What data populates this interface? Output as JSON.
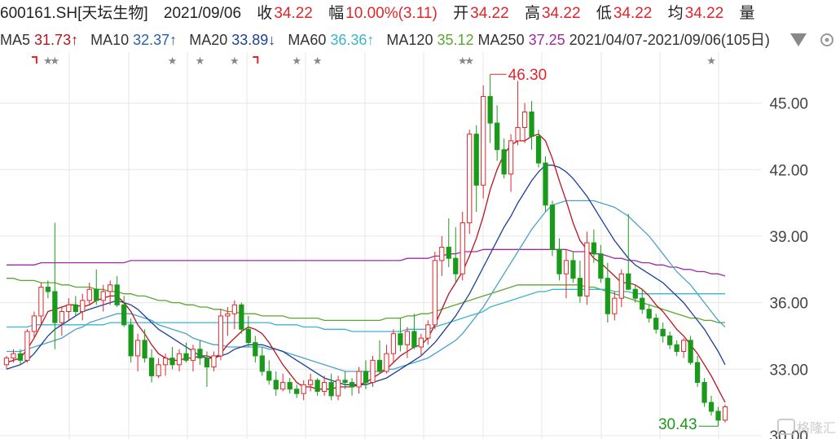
{
  "header": {
    "code": "600161.SH[天坛生物]",
    "date": "2021/09/06",
    "close_label": "收",
    "close": "34.22",
    "change_label": "幅",
    "change": "10.00%(3.11)",
    "open_label": "开",
    "open": "34.22",
    "high_label": "高",
    "high": "34.22",
    "low_label": "低",
    "low": "34.22",
    "avg_label": "均",
    "avg": "34.22",
    "vol_label": "量"
  },
  "ma_bar": {
    "ma5": "MA5",
    "ma5_val": "31.73↑",
    "ma10": "MA10",
    "ma10_val": "32.37↑",
    "ma20": "MA20",
    "ma20_val": "33.89↓",
    "ma60": "MA60",
    "ma60_val": "36.36↑",
    "ma120": "MA120",
    "ma120_val": "35.12",
    "ma250": "MA250",
    "ma250_val": "37.25",
    "range": "2021/04/07-2021/09/06(105日)",
    "dropdown_icon": "triangle-down-icon",
    "settings_icon": "settings-icon"
  },
  "colors": {
    "up": "#e0262b",
    "down": "#1a9a1a",
    "ma5": "#b8141e",
    "ma10": "#1e3f9a",
    "ma20": "#4aa3c8",
    "ma60": "#3ab5cf",
    "ma120": "#5aa630",
    "ma250": "#a02aa0"
  },
  "chart_data": {
    "type": "candlestick",
    "ylim": [
      29.85,
      47.3
    ],
    "yticks": [
      "45.00",
      "42.00",
      "39.00",
      "36.00",
      "33.00",
      "30.00"
    ],
    "ytick_values": [
      45,
      42,
      39,
      36,
      33,
      30
    ],
    "annotations": {
      "high": "46.30",
      "high_value": 46.3,
      "low": "30.43",
      "low_value": 30.43
    },
    "candles": [
      [
        33.2,
        33.6,
        33.0,
        33.5
      ],
      [
        33.5,
        33.9,
        33.3,
        33.7
      ],
      [
        33.7,
        33.9,
        33.2,
        33.4
      ],
      [
        33.4,
        34.8,
        33.3,
        34.7
      ],
      [
        34.7,
        35.6,
        34.4,
        35.4
      ],
      [
        35.4,
        36.9,
        35.0,
        36.7
      ],
      [
        36.7,
        37.0,
        36.2,
        36.5
      ],
      [
        36.5,
        39.6,
        33.9,
        35.1
      ],
      [
        35.1,
        35.8,
        34.5,
        35.6
      ],
      [
        35.6,
        36.2,
        35.2,
        35.9
      ],
      [
        35.9,
        36.3,
        35.4,
        35.6
      ],
      [
        35.6,
        36.4,
        35.2,
        36.1
      ],
      [
        36.1,
        36.9,
        35.9,
        36.6
      ],
      [
        36.6,
        37.5,
        35.9,
        36.1
      ],
      [
        36.1,
        36.8,
        35.6,
        36.5
      ],
      [
        36.5,
        37.0,
        35.9,
        36.8
      ],
      [
        36.8,
        37.2,
        35.8,
        35.9
      ],
      [
        35.9,
        36.3,
        34.9,
        35.0
      ],
      [
        35.0,
        35.3,
        33.3,
        33.6
      ],
      [
        33.6,
        34.6,
        32.9,
        34.3
      ],
      [
        34.3,
        34.8,
        33.3,
        33.5
      ],
      [
        33.5,
        33.9,
        32.4,
        32.7
      ],
      [
        32.7,
        33.5,
        32.6,
        33.2
      ],
      [
        33.2,
        33.7,
        32.7,
        33.5
      ],
      [
        33.5,
        34.0,
        33.0,
        33.2
      ],
      [
        33.2,
        33.9,
        32.9,
        33.7
      ],
      [
        33.7,
        34.2,
        33.3,
        33.4
      ],
      [
        33.4,
        34.1,
        32.9,
        33.9
      ],
      [
        33.9,
        34.3,
        33.2,
        33.5
      ],
      [
        33.5,
        33.8,
        32.2,
        33.1
      ],
      [
        33.1,
        33.8,
        32.9,
        33.6
      ],
      [
        33.6,
        35.7,
        33.4,
        35.4
      ],
      [
        35.4,
        35.8,
        34.5,
        35.5
      ],
      [
        35.5,
        36.1,
        34.8,
        35.9
      ],
      [
        35.9,
        36.0,
        34.6,
        34.8
      ],
      [
        34.8,
        35.4,
        34.0,
        34.2
      ],
      [
        34.2,
        34.5,
        33.3,
        33.6
      ],
      [
        33.6,
        34.0,
        32.7,
        32.9
      ],
      [
        32.9,
        33.4,
        32.3,
        32.5
      ],
      [
        32.5,
        32.9,
        31.8,
        32.1
      ],
      [
        32.1,
        32.8,
        32.0,
        32.4
      ],
      [
        32.4,
        32.6,
        31.9,
        32.1
      ],
      [
        32.1,
        32.3,
        31.7,
        31.9
      ],
      [
        31.9,
        32.5,
        31.6,
        32.3
      ],
      [
        32.3,
        32.8,
        32.0,
        32.5
      ],
      [
        32.5,
        32.6,
        31.8,
        32.0
      ],
      [
        32.0,
        32.7,
        31.8,
        32.4
      ],
      [
        32.4,
        32.8,
        31.6,
        31.8
      ],
      [
        31.8,
        32.7,
        31.6,
        32.5
      ],
      [
        32.5,
        32.9,
        32.1,
        32.4
      ],
      [
        32.4,
        32.6,
        31.8,
        32.2
      ],
      [
        32.2,
        33.1,
        31.9,
        32.9
      ],
      [
        32.9,
        33.4,
        32.1,
        32.4
      ],
      [
        32.4,
        33.6,
        32.2,
        33.4
      ],
      [
        33.4,
        34.3,
        32.8,
        32.9
      ],
      [
        32.9,
        34.1,
        32.8,
        33.7
      ],
      [
        33.7,
        34.8,
        33.3,
        34.6
      ],
      [
        34.6,
        35.3,
        33.8,
        34.1
      ],
      [
        34.1,
        34.9,
        33.5,
        34.7
      ],
      [
        34.7,
        35.5,
        33.9,
        34.0
      ],
      [
        34.0,
        34.6,
        33.6,
        34.4
      ],
      [
        34.4,
        35.2,
        34.1,
        35.0
      ],
      [
        35.0,
        38.3,
        34.8,
        37.9
      ],
      [
        37.9,
        39.0,
        37.2,
        38.5
      ],
      [
        38.5,
        39.8,
        37.6,
        38.0
      ],
      [
        38.0,
        39.4,
        36.9,
        37.3
      ],
      [
        37.3,
        40.1,
        37.0,
        39.6
      ],
      [
        39.6,
        43.8,
        39.1,
        43.6
      ],
      [
        43.6,
        44.0,
        40.1,
        41.3
      ],
      [
        41.3,
        45.8,
        40.7,
        45.3
      ],
      [
        45.3,
        46.3,
        43.2,
        44.1
      ],
      [
        44.1,
        44.9,
        42.4,
        42.9
      ],
      [
        42.9,
        43.4,
        41.6,
        41.8
      ],
      [
        41.8,
        43.6,
        41.0,
        43.3
      ],
      [
        43.3,
        46.0,
        43.1,
        43.9
      ],
      [
        43.9,
        45.0,
        43.2,
        44.6
      ],
      [
        44.6,
        45.1,
        42.9,
        43.5
      ],
      [
        43.5,
        43.8,
        42.1,
        42.3
      ],
      [
        42.3,
        42.6,
        40.1,
        40.4
      ],
      [
        40.4,
        40.6,
        38.1,
        38.4
      ],
      [
        38.4,
        38.9,
        37.0,
        37.3
      ],
      [
        37.3,
        38.4,
        36.2,
        37.9
      ],
      [
        37.9,
        38.3,
        36.9,
        37.1
      ],
      [
        37.1,
        37.9,
        36.0,
        36.3
      ],
      [
        36.3,
        39.2,
        35.9,
        38.7
      ],
      [
        38.7,
        39.3,
        37.8,
        38.2
      ],
      [
        38.2,
        38.6,
        36.9,
        37.1
      ],
      [
        37.1,
        37.8,
        35.1,
        35.5
      ],
      [
        35.5,
        36.5,
        35.2,
        36.2
      ],
      [
        36.2,
        37.5,
        35.8,
        37.3
      ],
      [
        37.3,
        40.0,
        36.9,
        36.6
      ],
      [
        36.6,
        36.8,
        36.0,
        36.2
      ],
      [
        36.2,
        36.6,
        35.5,
        35.7
      ],
      [
        35.7,
        35.9,
        35.1,
        35.3
      ],
      [
        35.3,
        35.5,
        34.6,
        34.8
      ],
      [
        34.8,
        35.1,
        34.2,
        34.5
      ],
      [
        34.5,
        34.7,
        33.9,
        34.1
      ],
      [
        34.1,
        34.3,
        33.6,
        33.8
      ],
      [
        33.8,
        34.4,
        33.5,
        34.3
      ],
      [
        34.3,
        34.5,
        33.2,
        33.3
      ],
      [
        33.3,
        33.6,
        32.2,
        32.4
      ],
      [
        32.4,
        32.6,
        31.3,
        31.5
      ],
      [
        31.5,
        31.8,
        30.9,
        31.1
      ],
      [
        31.1,
        31.3,
        30.43,
        30.7
      ],
      [
        30.7,
        31.4,
        30.6,
        31.3
      ]
    ],
    "series": [
      {
        "name": "MA5",
        "values": [
          33.3,
          33.4,
          33.5,
          33.9,
          34.4,
          35.0,
          35.6,
          35.7,
          35.8,
          35.9,
          35.9,
          35.8,
          35.9,
          36.1,
          36.2,
          36.3,
          36.3,
          36.0,
          35.6,
          35.0,
          34.6,
          34.1,
          33.7,
          33.5,
          33.4,
          33.4,
          33.5,
          33.5,
          33.6,
          33.6,
          33.5,
          33.7,
          34.1,
          34.4,
          34.7,
          34.9,
          34.8,
          34.6,
          34.2,
          33.7,
          33.2,
          32.8,
          32.4,
          32.2,
          32.2,
          32.1,
          32.1,
          32.1,
          32.2,
          32.2,
          32.2,
          32.3,
          32.4,
          32.6,
          32.8,
          33.0,
          33.3,
          33.6,
          33.8,
          34.0,
          34.1,
          34.4,
          35.0,
          35.7,
          36.4,
          36.9,
          37.4,
          38.1,
          38.9,
          39.9,
          41.1,
          42.0,
          42.7,
          43.1,
          43.3,
          43.3,
          43.5,
          43.6,
          43.3,
          42.5,
          41.5,
          40.6,
          39.6,
          38.8,
          38.4,
          38.0,
          37.8,
          37.5,
          37.2,
          36.9,
          36.9,
          36.8,
          36.6,
          36.3,
          35.9,
          35.6,
          35.2,
          34.8,
          34.5,
          34.1,
          33.7,
          33.2,
          32.7,
          32.1,
          31.5
        ]
      },
      {
        "name": "MA10",
        "values": [
          33.0,
          33.1,
          33.2,
          33.4,
          33.7,
          34.1,
          34.5,
          34.8,
          35.0,
          35.2,
          35.4,
          35.6,
          35.7,
          35.8,
          35.9,
          36.0,
          36.1,
          36.0,
          35.9,
          35.7,
          35.4,
          35.1,
          34.8,
          34.6,
          34.4,
          34.2,
          34.0,
          33.8,
          33.6,
          33.5,
          33.5,
          33.6,
          33.7,
          33.9,
          34.0,
          34.1,
          34.1,
          34.1,
          34.0,
          33.9,
          33.8,
          33.6,
          33.4,
          33.2,
          33.0,
          32.8,
          32.6,
          32.5,
          32.4,
          32.3,
          32.3,
          32.3,
          32.3,
          32.4,
          32.5,
          32.6,
          32.8,
          33.0,
          33.2,
          33.4,
          33.6,
          33.9,
          34.2,
          34.6,
          35.0,
          35.4,
          35.9,
          36.4,
          37.0,
          37.6,
          38.2,
          38.8,
          39.4,
          39.9,
          40.5,
          41.0,
          41.5,
          41.9,
          42.2,
          42.2,
          42.1,
          41.9,
          41.6,
          41.2,
          40.8,
          40.3,
          39.8,
          39.3,
          38.8,
          38.4,
          38.0,
          37.7,
          37.5,
          37.3,
          37.1,
          36.9,
          36.6,
          36.3,
          36.0,
          35.6,
          35.2,
          34.8,
          34.3,
          33.8,
          33.2
        ]
      },
      {
        "name": "MA20",
        "values": [
          33.8,
          33.8,
          33.8,
          33.9,
          34.0,
          34.1,
          34.2,
          34.3,
          34.4,
          34.6,
          34.8,
          34.9,
          35.1,
          35.2,
          35.3,
          35.4,
          35.5,
          35.5,
          35.5,
          35.4,
          35.3,
          35.2,
          35.0,
          34.9,
          34.8,
          34.7,
          34.6,
          34.4,
          34.3,
          34.2,
          34.1,
          34.1,
          34.0,
          34.0,
          34.0,
          34.0,
          34.0,
          34.0,
          33.9,
          33.9,
          33.8,
          33.7,
          33.6,
          33.5,
          33.4,
          33.3,
          33.2,
          33.1,
          33.0,
          32.9,
          32.9,
          32.9,
          32.9,
          32.9,
          32.9,
          33.0,
          33.0,
          33.1,
          33.2,
          33.3,
          33.4,
          33.5,
          33.7,
          33.9,
          34.1,
          34.3,
          34.6,
          35.0,
          35.4,
          35.8,
          36.3,
          36.8,
          37.3,
          37.8,
          38.3,
          38.8,
          39.3,
          39.7,
          40.1,
          40.4,
          40.5,
          40.6,
          40.6,
          40.6,
          40.6,
          40.6,
          40.5,
          40.4,
          40.3,
          40.1,
          39.9,
          39.6,
          39.3,
          39.0,
          38.6,
          38.2,
          37.8,
          37.4,
          37.1,
          36.8,
          36.4,
          36.0,
          35.6,
          35.2,
          34.9
        ]
      },
      {
        "name": "MA60",
        "values": [
          34.9,
          34.9,
          34.9,
          34.9,
          35.0,
          35.0,
          35.0,
          35.0,
          35.0,
          35.0,
          35.0,
          35.0,
          35.0,
          35.0,
          35.0,
          35.1,
          35.1,
          35.1,
          35.1,
          35.1,
          35.1,
          35.1,
          35.1,
          35.1,
          35.1,
          35.1,
          35.1,
          35.1,
          35.1,
          35.1,
          35.1,
          35.1,
          35.1,
          35.1,
          35.1,
          35.1,
          35.1,
          35.1,
          35.1,
          35.0,
          35.0,
          35.0,
          35.0,
          34.9,
          34.9,
          34.9,
          34.8,
          34.8,
          34.8,
          34.8,
          34.7,
          34.7,
          34.7,
          34.7,
          34.7,
          34.7,
          34.7,
          34.7,
          34.8,
          34.8,
          34.8,
          34.8,
          34.9,
          35.0,
          35.1,
          35.2,
          35.3,
          35.4,
          35.5,
          35.6,
          35.8,
          35.9,
          36.0,
          36.1,
          36.2,
          36.3,
          36.4,
          36.5,
          36.5,
          36.6,
          36.6,
          36.6,
          36.6,
          36.6,
          36.6,
          36.6,
          36.6,
          36.6,
          36.5,
          36.5,
          36.5,
          36.4,
          36.4,
          36.4,
          36.4,
          36.4,
          36.4,
          36.4,
          36.4,
          36.4,
          36.4,
          36.4,
          36.4,
          36.4,
          36.4
        ]
      },
      {
        "name": "MA120",
        "values": [
          37.1,
          37.1,
          37.0,
          37.0,
          37.0,
          36.9,
          36.9,
          36.9,
          36.8,
          36.8,
          36.7,
          36.7,
          36.7,
          36.6,
          36.6,
          36.5,
          36.5,
          36.4,
          36.4,
          36.3,
          36.3,
          36.2,
          36.1,
          36.1,
          36.0,
          36.0,
          35.9,
          35.9,
          35.8,
          35.8,
          35.7,
          35.7,
          35.6,
          35.6,
          35.5,
          35.5,
          35.5,
          35.4,
          35.4,
          35.4,
          35.4,
          35.3,
          35.3,
          35.3,
          35.3,
          35.3,
          35.2,
          35.2,
          35.2,
          35.2,
          35.2,
          35.2,
          35.2,
          35.2,
          35.2,
          35.3,
          35.3,
          35.3,
          35.4,
          35.4,
          35.5,
          35.5,
          35.6,
          35.7,
          35.8,
          35.9,
          36.0,
          36.1,
          36.2,
          36.3,
          36.4,
          36.5,
          36.6,
          36.7,
          36.8,
          36.8,
          36.8,
          36.8,
          36.8,
          36.8,
          36.8,
          36.8,
          36.8,
          36.8,
          36.7,
          36.7,
          36.6,
          36.5,
          36.4,
          36.3,
          36.2,
          36.1,
          36.0,
          35.9,
          35.8,
          35.7,
          35.6,
          35.5,
          35.4,
          35.3,
          35.3,
          35.2,
          35.2,
          35.1,
          35.1
        ]
      },
      {
        "name": "MA250",
        "values": [
          37.7,
          37.7,
          37.7,
          37.7,
          37.7,
          37.8,
          37.8,
          37.8,
          37.8,
          37.8,
          37.8,
          37.8,
          37.8,
          37.8,
          37.8,
          37.8,
          37.8,
          37.8,
          37.9,
          37.9,
          37.9,
          37.9,
          37.9,
          37.9,
          37.9,
          37.9,
          37.9,
          37.9,
          37.9,
          37.9,
          37.9,
          37.9,
          37.9,
          37.9,
          37.9,
          37.9,
          37.9,
          37.9,
          37.9,
          37.9,
          37.9,
          37.9,
          37.9,
          37.9,
          37.9,
          37.9,
          37.9,
          37.9,
          37.9,
          37.9,
          37.9,
          37.9,
          37.9,
          37.9,
          37.9,
          37.9,
          37.9,
          37.9,
          38.0,
          38.0,
          38.0,
          38.0,
          38.1,
          38.1,
          38.2,
          38.2,
          38.3,
          38.3,
          38.3,
          38.4,
          38.4,
          38.4,
          38.4,
          38.4,
          38.4,
          38.4,
          38.4,
          38.4,
          38.4,
          38.4,
          38.4,
          38.4,
          38.3,
          38.3,
          38.3,
          38.2,
          38.2,
          38.1,
          38.0,
          38.0,
          37.9,
          37.9,
          37.8,
          37.8,
          37.7,
          37.7,
          37.6,
          37.6,
          37.5,
          37.5,
          37.4,
          37.4,
          37.3,
          37.3,
          37.2
        ]
      }
    ],
    "star_marks": [
      6,
      7,
      24,
      28,
      33,
      42,
      45,
      66,
      67,
      102
    ],
    "flag_marks": [
      4,
      36
    ],
    "grid": true
  }
}
